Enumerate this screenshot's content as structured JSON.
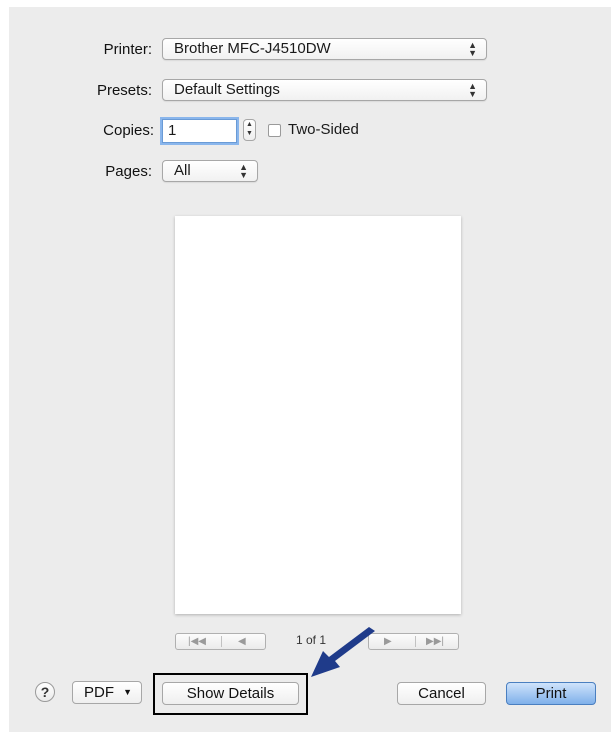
{
  "printer": {
    "label": "Printer:",
    "value": "Brother MFC-J4510DW"
  },
  "presets": {
    "label": "Presets:",
    "value": "Default Settings"
  },
  "copies": {
    "label": "Copies:",
    "value": "1",
    "two_sided_label": "Two-Sided",
    "two_sided_checked": false
  },
  "pages": {
    "label": "Pages:",
    "value": "All"
  },
  "pager": {
    "current_text": "1 of 1"
  },
  "buttons": {
    "help": "?",
    "pdf": "PDF",
    "show_details": "Show Details",
    "cancel": "Cancel",
    "print": "Print"
  },
  "icons": {
    "popup_arrows": "updown-chevron-icon",
    "first_page": "first-page-icon",
    "prev_page": "prev-page-icon",
    "next_page": "next-page-icon",
    "last_page": "last-page-icon",
    "annotation_arrow": "arrow-annotation-icon"
  },
  "colors": {
    "accent": "#7fb0ea",
    "annotation": "#1f3b8a"
  }
}
